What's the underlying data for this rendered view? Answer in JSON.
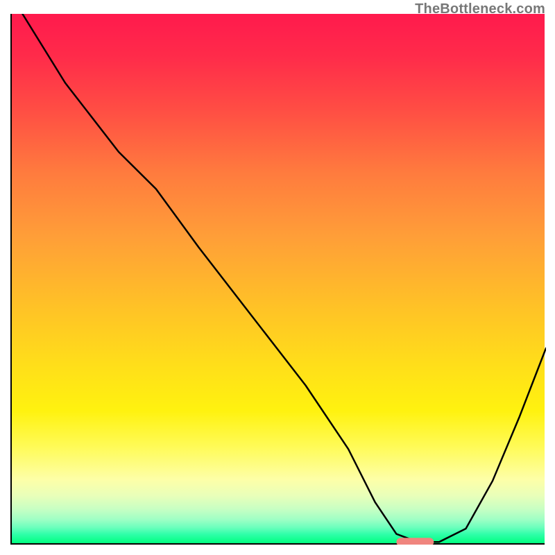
{
  "watermark": "TheBottleneck.com",
  "chart_data": {
    "type": "line",
    "title": "",
    "xlabel": "",
    "ylabel": "",
    "xlim": [
      0,
      100
    ],
    "ylim": [
      0,
      100
    ],
    "note": "Axes are unlabeled; values are normalized percentages estimated from position. Y represents mismatch/bottleneck percentage (top=100, bottom=0). Background color gradient maps green (low) to red (high).",
    "series": [
      {
        "name": "bottleneck-curve",
        "x": [
          2,
          10,
          20,
          27,
          35,
          45,
          55,
          63,
          68,
          72,
          76,
          80,
          85,
          90,
          95,
          100
        ],
        "y": [
          100,
          87,
          74,
          67,
          56,
          43,
          30,
          18,
          8,
          2,
          0.5,
          0.5,
          3,
          12,
          24,
          37
        ]
      }
    ],
    "marker": {
      "name": "optimal-range",
      "x_start": 72,
      "x_end": 79,
      "y": 0.5,
      "color": "#f0857e"
    }
  },
  "palette": {
    "axis": "#000000",
    "curve": "#000000",
    "marker": "#f0857e"
  }
}
